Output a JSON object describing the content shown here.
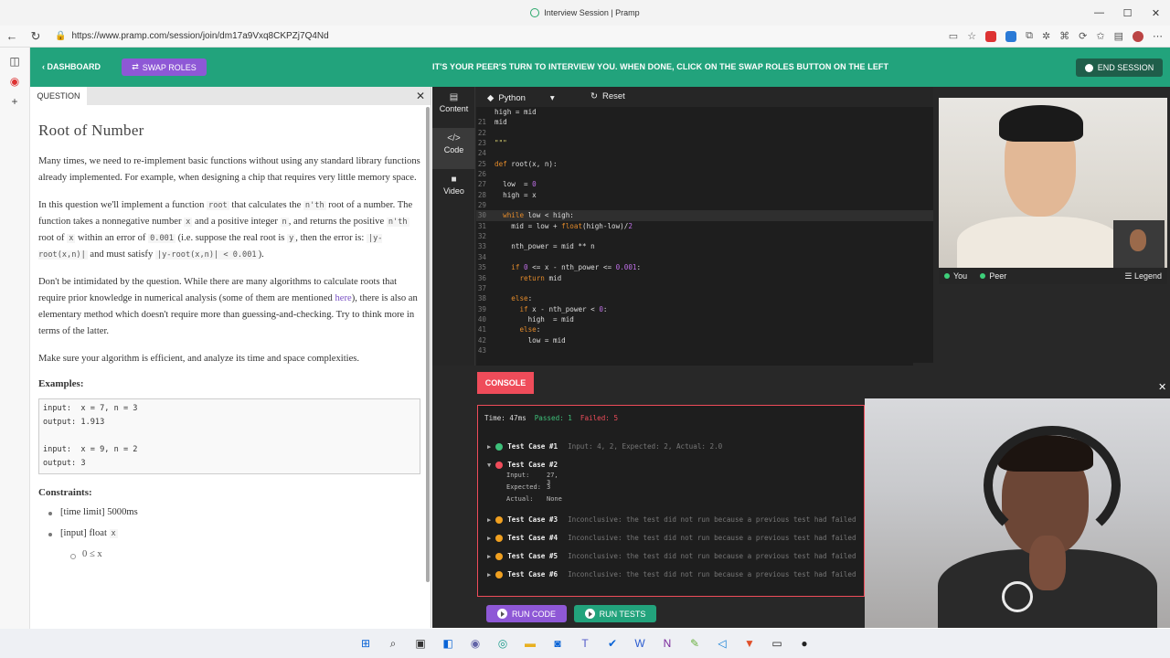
{
  "browser": {
    "title": "Interview Session | Pramp",
    "url": "https://www.pramp.com/session/join/dm17a9Vxq8CKPZj7Q4Nd",
    "window_controls": [
      "—",
      "☐",
      "✕"
    ]
  },
  "header": {
    "dashboard_label": "DASHBOARD",
    "swap_label": "SWAP ROLES",
    "message": "IT'S YOUR PEER'S TURN TO INTERVIEW YOU. WHEN DONE, CLICK ON THE SWAP ROLES BUTTON ON THE LEFT",
    "end_label": "END SESSION",
    "bg_color": "#22a37c",
    "accent_color": "#8e58d6"
  },
  "question": {
    "tab_label": "QUESTION",
    "title": "Root of Number",
    "p1": "Many times, we need to re-implement basic functions without using any standard library functions already implemented. For example, when designing a chip that requires very little memory space.",
    "p2_a": "In this question we'll implement a function ",
    "p2_root": "root",
    "p2_b": " that calculates the ",
    "p2_nth": "n'th",
    "p2_c": " root of a number. The function takes a nonnegative number ",
    "p2_x": "x",
    "p2_d": " and a positive integer ",
    "p2_n": "n",
    "p2_e": ", and returns the positive ",
    "p2_nth2": "n'th",
    "p2_f": " root of ",
    "p2_x2": "x",
    "p2_g": " within an error of ",
    "p2_err": "0.001",
    "p2_h": " (i.e. suppose the real root is ",
    "p2_y": "y",
    "p2_i": ", then the error is: ",
    "p2_abs": "|y-root(x,n)|",
    "p2_j": " and must satisfy ",
    "p2_ineq": "|y-root(x,n)| < 0.001",
    "p2_k": ").",
    "p3_a": "Don't be intimidated by the question. While there are many algorithms to calculate roots that require prior knowledge in numerical analysis (some of them are mentioned ",
    "p3_link": "here",
    "p3_b": "), there is also an elementary method which doesn't require more than guessing-and-checking. Try to think more in terms of the latter.",
    "p4": "Make sure your algorithm is efficient, and analyze its time and space complexities.",
    "examples_heading": "Examples:",
    "examples": "input:  x = 7, n = 3\noutput: 1.913\n\ninput:  x = 9, n = 2\noutput: 3",
    "constraints_heading": "Constraints:",
    "c1": "[time limit] 5000ms",
    "c2": "[input] float ",
    "c2_x": "x",
    "c3": "0 ≤ x"
  },
  "editor": {
    "tabs": [
      {
        "label": "Content",
        "icon": "document-icon"
      },
      {
        "label": "Code",
        "icon": "code-icon"
      },
      {
        "label": "Video",
        "icon": "video-icon"
      }
    ],
    "language": "Python",
    "reset_label": "Reset",
    "lines": [
      {
        "n": "",
        "t": "high = mid"
      },
      {
        "n": "21",
        "t": "mid"
      },
      {
        "n": "22",
        "t": ""
      },
      {
        "n": "23",
        "t": "\"\"\""
      },
      {
        "n": "24",
        "t": ""
      },
      {
        "n": "25",
        "t": "def root(x, n):"
      },
      {
        "n": "26",
        "t": ""
      },
      {
        "n": "27",
        "t": "  low  = 0"
      },
      {
        "n": "28",
        "t": "  high = x"
      },
      {
        "n": "29",
        "t": ""
      },
      {
        "n": "30",
        "t": "  while low < high:"
      },
      {
        "n": "31",
        "t": "    mid = low + float(high-low)/2"
      },
      {
        "n": "32",
        "t": ""
      },
      {
        "n": "33",
        "t": "    nth_power = mid ** n"
      },
      {
        "n": "34",
        "t": ""
      },
      {
        "n": "35",
        "t": "    if 0 <= x - nth_power <= 0.001:"
      },
      {
        "n": "36",
        "t": "      return mid"
      },
      {
        "n": "37",
        "t": ""
      },
      {
        "n": "38",
        "t": "    else:"
      },
      {
        "n": "39",
        "t": "      if x - nth_power < 0:"
      },
      {
        "n": "40",
        "t": "        high  = mid"
      },
      {
        "n": "41",
        "t": "      else:"
      },
      {
        "n": "42",
        "t": "        low = mid"
      },
      {
        "n": "43",
        "t": ""
      }
    ]
  },
  "video": {
    "you_label": "You",
    "peer_label": "Peer",
    "legend_label": "Legend"
  },
  "console": {
    "tab_label": "CONSOLE",
    "time": "Time: 47ms",
    "passed": "Passed: 1",
    "failed": "Failed: 5",
    "cases": [
      {
        "name": "Test Case #1",
        "status": "pass",
        "info": "Input: 4, 2, Expected: 2, Actual: 2.0"
      },
      {
        "name": "Test Case #2",
        "status": "fail",
        "info": ""
      },
      {
        "name": "Test Case #3",
        "status": "warn",
        "info": "Inconclusive: the test did not run because a previous test had failed"
      },
      {
        "name": "Test Case #4",
        "status": "warn",
        "info": "Inconclusive: the test did not run because a previous test had failed"
      },
      {
        "name": "Test Case #5",
        "status": "warn",
        "info": "Inconclusive: the test did not run because a previous test had failed"
      },
      {
        "name": "Test Case #6",
        "status": "warn",
        "info": "Inconclusive: the test did not run because a previous test had failed"
      }
    ],
    "case2_details": {
      "input_label": "Input:",
      "input_value": "27, 3",
      "expected_label": "Expected:",
      "expected_value": "3",
      "actual_label": "Actual:",
      "actual_value": "None"
    },
    "run_code_label": "RUN CODE",
    "run_tests_label": "RUN TESTS"
  }
}
